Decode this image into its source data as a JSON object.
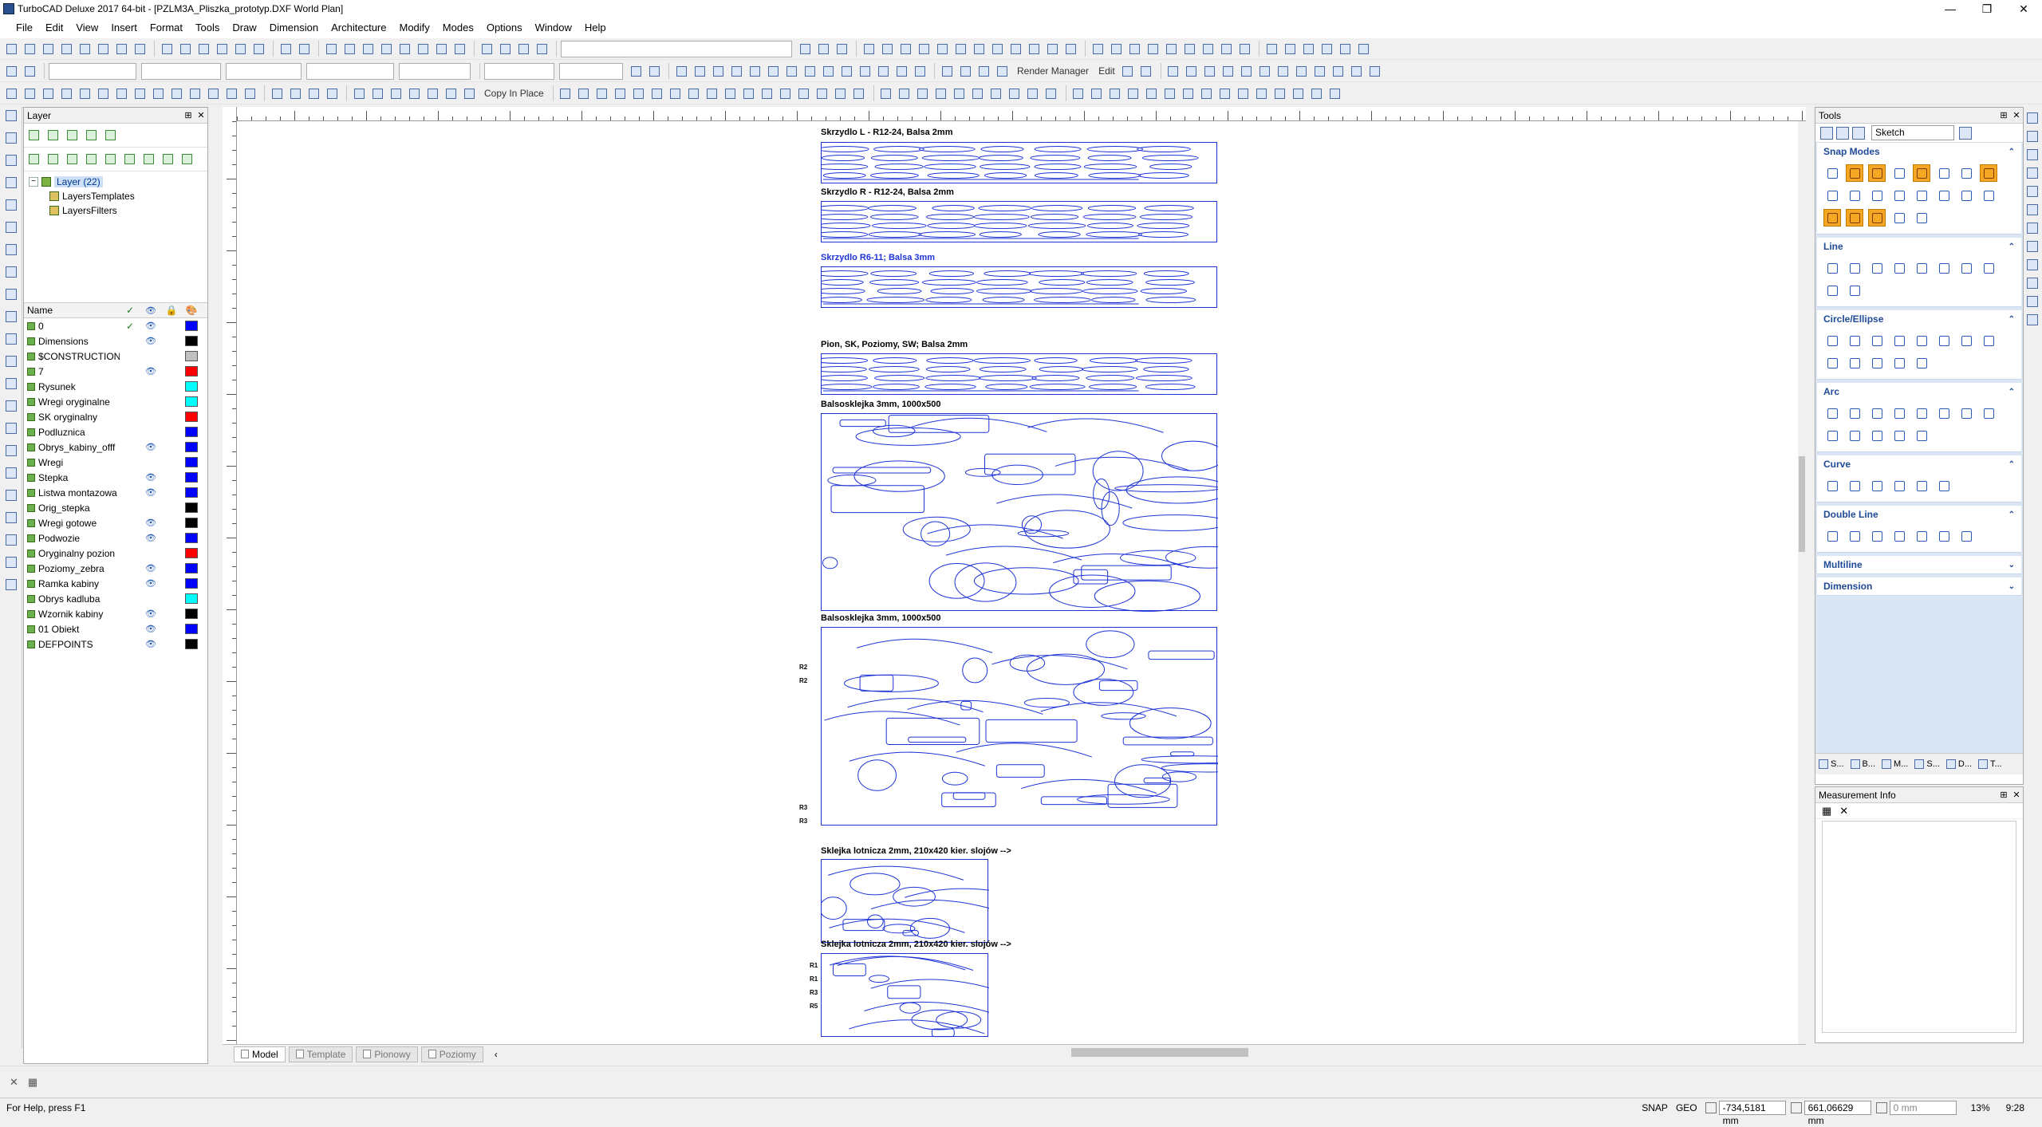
{
  "window": {
    "title": "TurboCAD Deluxe 2017 64-bit - [PZLM3A_Pliszka_prototyp.DXF World Plan]",
    "minimize": "—",
    "restore": "❐",
    "close": "✕"
  },
  "menu": [
    "File",
    "Edit",
    "View",
    "Insert",
    "Format",
    "Tools",
    "Draw",
    "Dimension",
    "Architecture",
    "Modify",
    "Modes",
    "Options",
    "Window",
    "Help"
  ],
  "toolbar": {
    "render_manager": "Render Manager",
    "edit": "Edit",
    "copy_in_place": "Copy In Place"
  },
  "layer_panel": {
    "title": "Layer",
    "tree_root": "Layer (22)",
    "tree_children": [
      "LayersTemplates",
      "LayersFilters"
    ],
    "col_name": "Name",
    "col_check": "✓",
    "col_visible": "👁",
    "col_lock": "🔒",
    "col_color": "🎨",
    "layers": [
      {
        "name": "0",
        "active": "✓",
        "visible": "👁",
        "color": "#0000ff"
      },
      {
        "name": "Dimensions",
        "active": "",
        "visible": "👁",
        "color": "#000000"
      },
      {
        "name": "$CONSTRUCTION",
        "active": "",
        "visible": "",
        "color": "#c0c0c0"
      },
      {
        "name": "7",
        "active": "",
        "visible": "👁",
        "color": "#ff0000"
      },
      {
        "name": "Rysunek",
        "active": "",
        "visible": "",
        "color": "#00ffff"
      },
      {
        "name": "Wregi oryginalne",
        "active": "",
        "visible": "",
        "color": "#00ffff"
      },
      {
        "name": "SK oryginalny",
        "active": "",
        "visible": "",
        "color": "#ff0000"
      },
      {
        "name": "Podluznica",
        "active": "",
        "visible": "",
        "color": "#0000ff"
      },
      {
        "name": "Obrys_kabiny_offf",
        "active": "",
        "visible": "👁",
        "color": "#0000ff"
      },
      {
        "name": "Wregi",
        "active": "",
        "visible": "",
        "color": "#0000ff"
      },
      {
        "name": "Stepka",
        "active": "",
        "visible": "👁",
        "color": "#0000ff"
      },
      {
        "name": "Listwa montazowa",
        "active": "",
        "visible": "👁",
        "color": "#0000ff"
      },
      {
        "name": "Orig_stepka",
        "active": "",
        "visible": "",
        "color": "#000000"
      },
      {
        "name": "Wregi gotowe",
        "active": "",
        "visible": "👁",
        "color": "#000000"
      },
      {
        "name": "Podwozie",
        "active": "",
        "visible": "👁",
        "color": "#0000ff"
      },
      {
        "name": "Oryginalny pozion",
        "active": "",
        "visible": "",
        "color": "#ff0000"
      },
      {
        "name": "Poziomy_zebra",
        "active": "",
        "visible": "👁",
        "color": "#0000ff"
      },
      {
        "name": "Ramka kabiny",
        "active": "",
        "visible": "👁",
        "color": "#0000ff"
      },
      {
        "name": "Obrys kadluba",
        "active": "",
        "visible": "",
        "color": "#00ffff"
      },
      {
        "name": "Wzornik kabiny",
        "active": "",
        "visible": "👁",
        "color": "#000000"
      },
      {
        "name": "01 Obiekt",
        "active": "",
        "visible": "👁",
        "color": "#0000ff"
      },
      {
        "name": "DEFPOINTS",
        "active": "",
        "visible": "👁",
        "color": "#000000"
      }
    ]
  },
  "drawing": {
    "sheets": [
      {
        "label": "Skrzydlo L - R12-24, Balsa 2mm"
      },
      {
        "label": "Skrzydlo R - R12-24, Balsa 2mm"
      },
      {
        "label": "Skrzydlo R6-11; Balsa 3mm"
      },
      {
        "label": "Pion, SK, Poziomy, SW; Balsa 2mm"
      },
      {
        "label": "Balsosklejka 3mm, 1000x500"
      },
      {
        "label": "Balsosklejka 3mm, 1000x500"
      },
      {
        "label": "Sklejka lotnicza 2mm, 210x420 kier. slojów -->"
      },
      {
        "label": "Sklejka lotnicza 2mm, 210x420 kier. slojów -->"
      }
    ],
    "rib_labels_a": [
      "R2",
      "R2",
      "R3",
      "R3"
    ],
    "rib_labels_b": [
      "R1",
      "R1",
      "R3",
      "R5"
    ]
  },
  "bottom_tabs": [
    "Model",
    "Template",
    "Pionowy",
    "Poziomy"
  ],
  "tools_panel": {
    "title": "Tools",
    "mode": "Sketch",
    "sections": [
      {
        "name": "Snap Modes",
        "chev": "⌃"
      },
      {
        "name": "Line",
        "chev": "⌃"
      },
      {
        "name": "Circle/Ellipse",
        "chev": "⌃"
      },
      {
        "name": "Arc",
        "chev": "⌃"
      },
      {
        "name": "Curve",
        "chev": "⌃"
      },
      {
        "name": "Double Line",
        "chev": "⌃"
      },
      {
        "name": "Multiline",
        "chev": "⌄"
      },
      {
        "name": "Dimension",
        "chev": "⌄"
      }
    ],
    "bottom_tabs": [
      "S...",
      "B...",
      "M...",
      "S...",
      "D...",
      "T..."
    ]
  },
  "measurement_panel": {
    "title": "Measurement Info",
    "grid": "▦",
    "clear": "✕"
  },
  "status": {
    "help": "For Help, press F1",
    "snap": "SNAP",
    "geo": "GEO",
    "x": "-734,5181 mm",
    "y": "661,06629 mm",
    "z": "0 mm",
    "zoom": "13%",
    "time": "9:28"
  }
}
